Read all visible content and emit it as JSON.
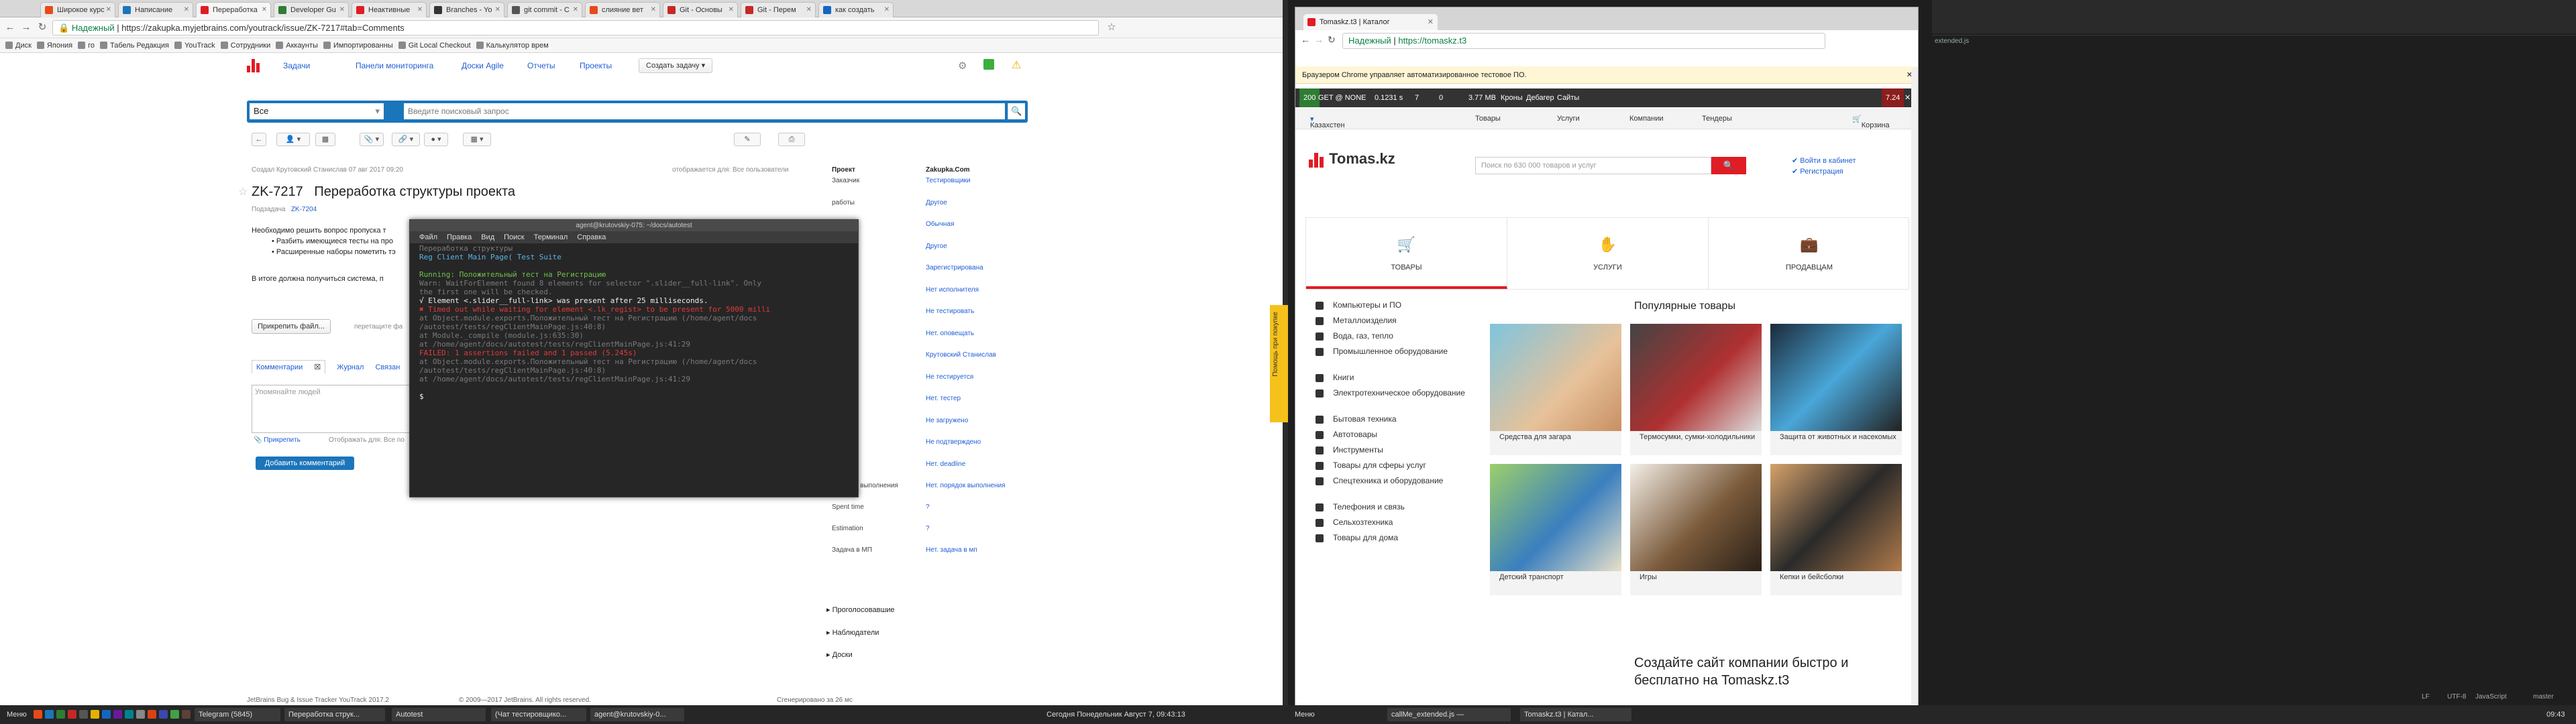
{
  "left_browser": {
    "tabs": [
      "Широкое курс",
      "Написание",
      "Переработка",
      "Developer Gu",
      "Неактивные",
      "Branches - Yo",
      "git commit - С",
      "слияние вет",
      "Git - Основы",
      "Git - Перем",
      "как создать"
    ],
    "active_tab": 2,
    "secure_label": "Надежный",
    "url": "https://zakupka.myjetbrains.com/youtrack/issue/ZK-7217#tab=Comments",
    "bookmarks": [
      "Диск",
      "Япония",
      "го",
      "Табель Редакция",
      "YouTrack",
      "Сотрудники",
      "Аккаунты",
      "Импортированны",
      "Git Local Checkout",
      "Калькулятор врем"
    ]
  },
  "youtrack": {
    "nav": [
      "Задачи",
      "Панели мониторинга",
      "Доски Agile",
      "Отчеты",
      "Проекты"
    ],
    "create_issue": "Создать задачу",
    "search_context": "Все",
    "search_placeholder": "Введите поисковый запрос",
    "created_text": "Создал Крутовский Станислав 07 авг 2017 09:20",
    "visible_to": "отображается для: Все пользователи",
    "issue_id": "ZK-7217",
    "issue_title": "Переработка структуры проекта",
    "subtask_label": "Подзадача",
    "subtask_value": "ZK-7204",
    "body_intro": "Необходимо решить вопрос пропуска т",
    "bullet1": "Разбить имеющиеся тесты на про",
    "bullet2": "Расширенные наборы пометить тэ",
    "body_result": "В итоге должна получиться система, п",
    "attach_file": "Прикрепить файл...",
    "drop_hint": "перетащите фа",
    "comment_tabs": [
      "Комментарии",
      "Журнал",
      "Связан"
    ],
    "comment_placeholder": "Упомянайте людей",
    "attach_comment": "Прикрепить",
    "visible_for": "Отображать для: Все по",
    "add_comment": "Добавить комментарий",
    "project_key": "Проект",
    "project_value": "Zakupka.Com",
    "fields": [
      {
        "k": "Заказчик",
        "v": "Тестировщики"
      },
      {
        "k": "работы",
        "v": "Другое"
      },
      {
        "k": "итет",
        "v": "Обычная"
      },
      {
        "k": "",
        "v": "Другое"
      },
      {
        "k": "ние",
        "v": "Зарегистрирована"
      },
      {
        "k": "итель",
        "v": "Нет исполнителя"
      },
      {
        "k": "ровать",
        "v": "Не тестировать"
      },
      {
        "k": "щить",
        "v": "Нет. оповещать"
      },
      {
        "k": "ненный",
        "v": "Крутовский Станислав"
      },
      {
        "k": "ование",
        "v": "Не тестируется"
      },
      {
        "k": "",
        "v": "Нет. тестер"
      },
      {
        "k": "ено",
        "v": "Не загружено"
      },
      {
        "k": "рждено",
        "v": "Не подтверждено"
      },
      {
        "k": "",
        "v": "Нет. deadline"
      },
      {
        "k": "Порядок выполнения",
        "v": "Нет. порядок выполнения"
      },
      {
        "k": "Spent time",
        "v": "?"
      },
      {
        "k": "Estimation",
        "v": "?"
      },
      {
        "k": "Задача в МП",
        "v": "Нет. задача в мп"
      }
    ],
    "sections": [
      "Проголосовавшие",
      "Наблюдатели",
      "Доски"
    ],
    "footer_left": "JetBrains Bug & Issue Tracker YouTrack 2017.2",
    "footer_mid": "© 2009—2017 JetBrains. All rights reserved.",
    "footer_right": "Сгенерировано за 26 мс"
  },
  "terminal": {
    "title": "agent@krutovskiy-075: ~/docs/autotest",
    "menu": [
      "Файл",
      "Правка",
      "Вид",
      "Поиск",
      "Терминал",
      "Справка"
    ],
    "lines": [
      {
        "c": "d",
        "t": "Переработка структуры"
      },
      {
        "c": "c",
        "t": "Reg Client Main Page( Test Suite"
      },
      {
        "c": "d",
        "t": ""
      },
      {
        "c": "g",
        "t": "Running:  Положительный тест на Регистрацию"
      },
      {
        "c": "d",
        "t": " Warn: WaitForElement found 8 elements for selector \".slider__full-link\". Only"
      },
      {
        "c": "d",
        "t": " the first one will be checked."
      },
      {
        "c": "w",
        "t": " √ Element <.slider__full-link> was present after 25 milliseconds."
      },
      {
        "c": "r",
        "t": "   ✖ Timed out while waiting for element <.lk_regist> to be present for 5000 milli"
      },
      {
        "c": "d",
        "t": "     at Object.module.exports.Положительный тест на Регистрацию (/home/agent/docs"
      },
      {
        "c": "d",
        "t": "     /autotest/tests/regClientMainPage.js:40:8)"
      },
      {
        "c": "d",
        "t": "     at Module._compile (module.js:635:30)"
      },
      {
        "c": "d",
        "t": "     at /home/agent/docs/autotest/tests/regClientMainPage.js:41:29"
      },
      {
        "c": "r",
        "t": " FAILED:  1 assertions failed and 1 passed (5.245s)"
      },
      {
        "c": "d",
        "t": "     at Object.module.exports.Положительный тест на Регистрацию (/home/agent/docs"
      },
      {
        "c": "d",
        "t": "     /autotest/tests/regClientMainPage.js:40:8)"
      },
      {
        "c": "d",
        "t": "     at /home/agent/docs/autotest/tests/regClientMainPage.js:41:29"
      },
      {
        "c": "d",
        "t": ""
      },
      {
        "c": "w",
        "t": "$ "
      }
    ]
  },
  "chrome": {
    "tab": "Tomaskz.t3 | Каталог",
    "secure": "Надежный",
    "url": "https://tomaskz.t3",
    "infobar": "Браузером Chrome управляет автоматизированное тестовое ПО.",
    "toolbar": [
      "200",
      "GET @ NONE",
      "0.1231 s",
      "7",
      "0",
      "3.77 MB",
      "Кроны",
      "Дебагер",
      "Сайты",
      "7.24"
    ],
    "region": "Казахстен",
    "topnav": [
      "Товары",
      "Услуги",
      "Компании",
      "Тендеры"
    ],
    "cart": "Корзина",
    "logo": "Tomas.kz",
    "search_placeholder": "Поиск по 630 000 товаров и услуг",
    "login": "Войти в кабинет",
    "register": "Регистрация",
    "big_tabs": [
      "ТОВАРЫ",
      "УСЛУГИ",
      "ПРОДАВЦАМ"
    ],
    "categories": [
      "Компьютеры и ПО",
      "Металлоизделия",
      "Вода, газ, тепло",
      "Промышленное оборудование",
      "Книги",
      "Электротехническое оборудование",
      "Бытовая техника",
      "Автотовары",
      "Инструменты",
      "Товары для сферы услуг",
      "Спецтехника и оборудование",
      "Телефония и связь",
      "Сельхозтехника",
      "Товары для дома"
    ],
    "popular_title": "Популярные товары",
    "products": [
      "Средства для загара",
      "Термосумки, сумки-холодильники",
      "Защита от животных и насекомых",
      "Детский транспорт",
      "Игры",
      "Кепки и бейсболки"
    ],
    "promo": "Создайте сайт компании быстро и бесплатно на Tomaskz.t3",
    "side_tag": "Помощь при покупке"
  },
  "atom": {
    "file": "extended.js",
    "status": [
      "LF",
      "UTF-8",
      "JavaScript",
      "master"
    ]
  },
  "taskbar": {
    "menu": "Меню",
    "items": [
      "Telegram (5845)",
      "Переработка струк...",
      "Autotest",
      "(Чат тестировщико...",
      "agent@krutovskiy-0..."
    ],
    "clock": "Сегодня Понедельник Август 7, 09:43:13",
    "right_items": [
      "Меню",
      "callMe_extended.js —",
      "Tomaskz.t3 | Катал..."
    ],
    "right_clock": "09:43"
  }
}
